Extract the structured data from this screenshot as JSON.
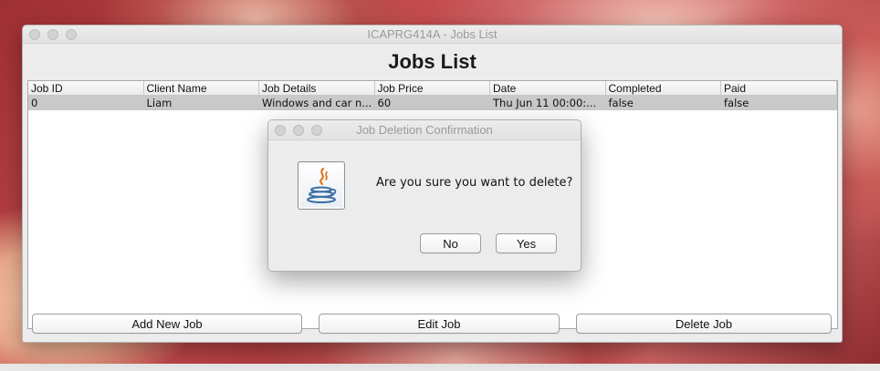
{
  "window": {
    "title": "ICAPRG414A - Jobs List",
    "heading": "Jobs List"
  },
  "table": {
    "columns": [
      "Job ID",
      "Client Name",
      "Job Details",
      "Job Price",
      "Date",
      "Completed",
      "Paid"
    ],
    "rows": [
      [
        "0",
        "Liam",
        "Windows and car n...",
        "60",
        "Thu Jun 11 00:00:...",
        "false",
        "false"
      ]
    ],
    "selected_row": 0
  },
  "buttons": {
    "add": "Add New Job",
    "edit": "Edit Job",
    "delete": "Delete Job"
  },
  "dialog": {
    "title": "Job Deletion Confirmation",
    "message": "Are you sure you want to delete?",
    "no_label": "No",
    "yes_label": "Yes",
    "icon": "java-icon"
  }
}
